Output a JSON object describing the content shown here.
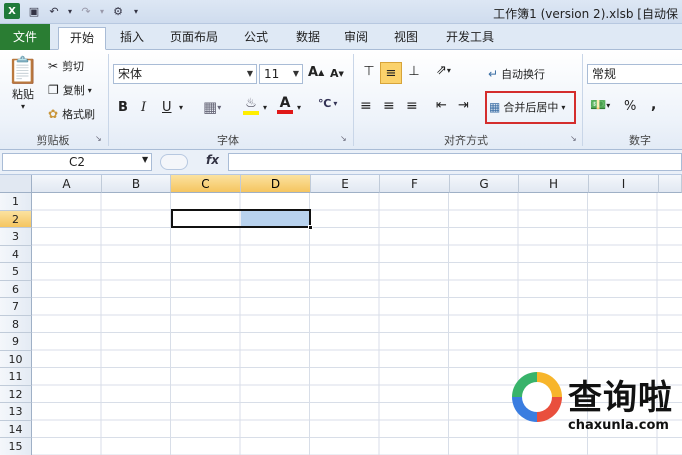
{
  "window": {
    "title": "工作簿1 (version 2).xlsb [自动保"
  },
  "tabs": [
    {
      "label": "文件"
    },
    {
      "label": "开始"
    },
    {
      "label": "插入"
    },
    {
      "label": "页面布局"
    },
    {
      "label": "公式"
    },
    {
      "label": "数据"
    },
    {
      "label": "审阅"
    },
    {
      "label": "视图"
    },
    {
      "label": "开发工具"
    }
  ],
  "clipboard": {
    "paste": "粘贴",
    "cut": "剪切",
    "copy": "复制",
    "format_painter": "格式刷",
    "group": "剪贴板"
  },
  "font": {
    "name": "宋体",
    "size": "11",
    "bold": "B",
    "italic": "I",
    "underline": "U",
    "grow": "A",
    "shrink": "A",
    "color_letter": "A",
    "group": "字体"
  },
  "alignment": {
    "wrap": "自动换行",
    "merge_center": "合并后居中",
    "group": "对齐方式"
  },
  "number": {
    "format": "常规",
    "percent": "%",
    "comma": ",",
    "group": "数字"
  },
  "formula_bar": {
    "name_box": "C2",
    "fx": "fx",
    "value": ""
  },
  "columns": [
    "A",
    "B",
    "C",
    "D",
    "E",
    "F",
    "G",
    "H",
    "I"
  ],
  "rows": [
    "1",
    "2",
    "3",
    "4",
    "5",
    "6",
    "7",
    "8",
    "9",
    "10",
    "11",
    "12",
    "13",
    "14",
    "15"
  ],
  "watermark": {
    "text": "查询啦",
    "url": "chaxunla.com"
  },
  "colors": {
    "file_tab": "#2a7d33",
    "selection": "#b8d2ee",
    "header_selected": "#f5c560",
    "highlight_box": "#d42d2d"
  }
}
